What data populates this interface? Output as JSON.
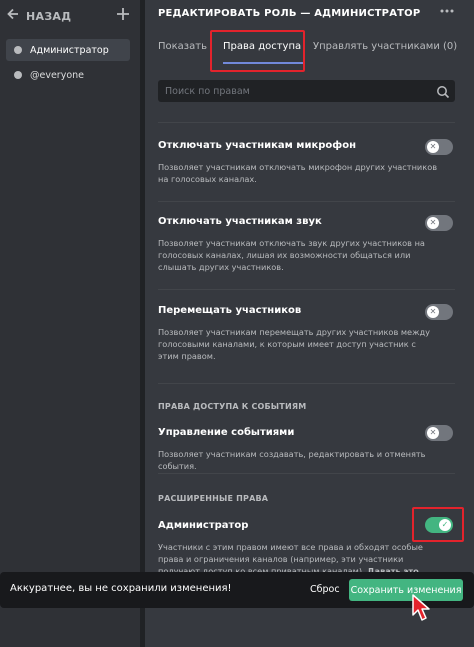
{
  "sidebar": {
    "back_label": "НАЗАД",
    "back_icon": "arrow-left-icon",
    "add_icon": "plus-icon",
    "roles": [
      {
        "label": "Администратор",
        "active": true
      },
      {
        "label": "@everyone",
        "active": false
      }
    ]
  },
  "header": {
    "title": "РЕДАКТИРОВАТЬ РОЛЬ — АДМИНИСТРАТОР",
    "more_icon": "more-horizontal-icon"
  },
  "tabs": [
    {
      "label": "Показать"
    },
    {
      "label": "Права доступа"
    },
    {
      "label": "Управлять участниками (0)"
    }
  ],
  "search": {
    "placeholder": "Поиск по правам"
  },
  "permissions": [
    {
      "title": "Отключать участникам микрофон",
      "description": "Позволяет участникам отключать микрофон других участников на голосовых каналах.",
      "enabled": false
    },
    {
      "title": "Отключать участникам звук",
      "description": "Позволяет участникам отключать звук других участников на голосовых каналах, лишая их возможности общаться или слышать других участников.",
      "enabled": false
    },
    {
      "title": "Перемещать участников",
      "description": "Позволяет участникам перемещать других участников между голосовыми каналами, к которым имеет доступ участник с этим правом.",
      "enabled": false
    }
  ],
  "events_section": {
    "header": "ПРАВА ДОСТУПА К СОБЫТИЯМ",
    "permission": {
      "title": "Управление событиями",
      "description": "Позволяет участникам создавать, редактировать и отменять события.",
      "enabled": false
    }
  },
  "advanced_section": {
    "header": "РАСШИРЕННЫЕ ПРАВА",
    "permission": {
      "title": "Администратор",
      "description": "Участники с этим правом имеют все права и обходят особые права и ограничения каналов (например, эти участники получают доступ ко всем приватным каналам).",
      "warning": "Давать это право опасно.",
      "enabled": true
    }
  },
  "notice": {
    "text": "Аккуратнее, вы не сохранили изменения!",
    "reset_label": "Сброс",
    "save_label": "Сохранить изменения"
  },
  "colors": {
    "accent": "#7289da",
    "success": "#43b581",
    "highlight": "#e3232c"
  }
}
